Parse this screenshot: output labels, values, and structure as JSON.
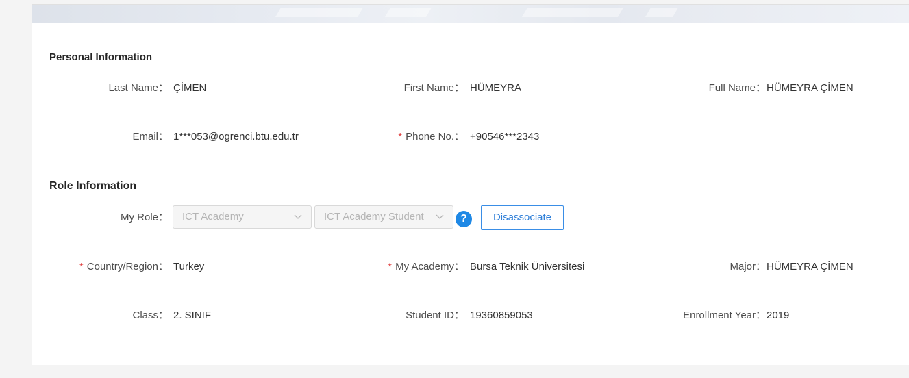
{
  "personal": {
    "title": "Personal Information",
    "last_name": {
      "label": "Last Name：",
      "value": "ÇİMEN"
    },
    "first_name": {
      "label": "First Name：",
      "value": "HÜMEYRA"
    },
    "full_name": {
      "label": "Full Name：",
      "value": "HÜMEYRA ÇİMEN"
    },
    "email": {
      "label": "Email：",
      "value": "1***053@ogrenci.btu.edu.tr"
    },
    "phone": {
      "required_mark": "*",
      "label": "Phone No.：",
      "value": "+90546***2343"
    }
  },
  "role": {
    "title": "Role Information",
    "my_role_label": "My Role：",
    "role_select_1": "ICT Academy",
    "role_select_2": "ICT Academy Student",
    "help_glyph": "?",
    "disassociate_label": "Disassociate",
    "country": {
      "required_mark": "*",
      "label": "Country/Region：",
      "value": "Turkey"
    },
    "academy": {
      "required_mark": "*",
      "label": "My Academy：",
      "value": "Bursa Teknik Üniversitesi"
    },
    "major": {
      "label": "Major：",
      "value": "HÜMEYRA ÇİMEN"
    },
    "class": {
      "label": "Class：",
      "value": "2. SINIF"
    },
    "student_id": {
      "label": "Student ID：",
      "value": "19360859053"
    },
    "enrollment_year": {
      "label": "Enrollment Year：",
      "value": "2019"
    }
  },
  "icons": {
    "chevron": "chevron-down-icon",
    "help": "question-circle-icon"
  },
  "colors": {
    "accent": "#1e88e5",
    "required": "#e04141",
    "button_border": "#3a8ee6"
  }
}
